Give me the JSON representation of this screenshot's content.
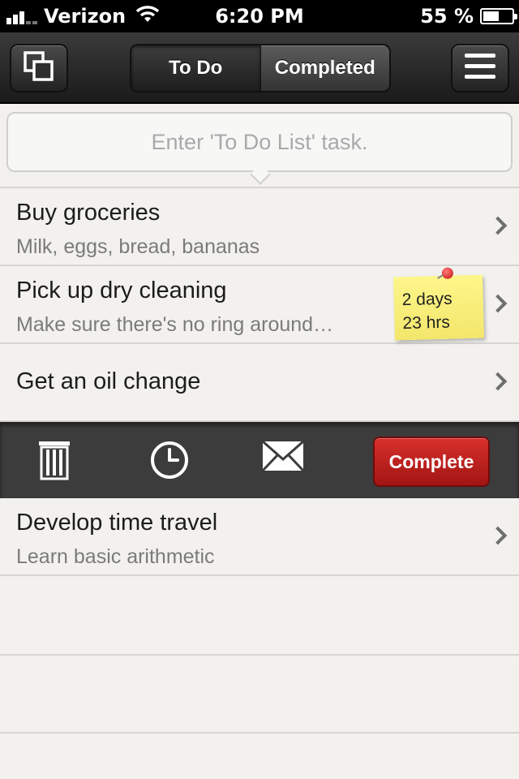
{
  "status_bar": {
    "carrier": "Verizon",
    "time": "6:20 PM",
    "battery_percent": "55 %",
    "battery_level": 0.55
  },
  "nav": {
    "left_icon": "copy-windows-icon",
    "tabs": [
      {
        "label": "To Do",
        "selected": true
      },
      {
        "label": "Completed",
        "selected": false
      }
    ],
    "right_icon": "menu-icon"
  },
  "input": {
    "placeholder": "Enter 'To Do List' task.",
    "value": ""
  },
  "tasks": [
    {
      "title": "Buy groceries",
      "subtitle": "Milk, eggs, bread, bananas"
    },
    {
      "title": "Pick up dry cleaning",
      "subtitle": "Make sure there's no ring around…",
      "due_line1": "2 days",
      "due_line2": "23 hrs"
    },
    {
      "title": "Get an oil change",
      "subtitle": ""
    },
    {
      "title": "Develop time travel",
      "subtitle": "Learn basic arithmetic"
    }
  ],
  "actions": {
    "icons": [
      "trash-icon",
      "clock-icon",
      "mail-icon"
    ],
    "complete_label": "Complete"
  },
  "colors": {
    "complete_red": "#c1201d",
    "sticky_yellow": "#fbf17c",
    "action_bar": "#3c3c3c"
  }
}
